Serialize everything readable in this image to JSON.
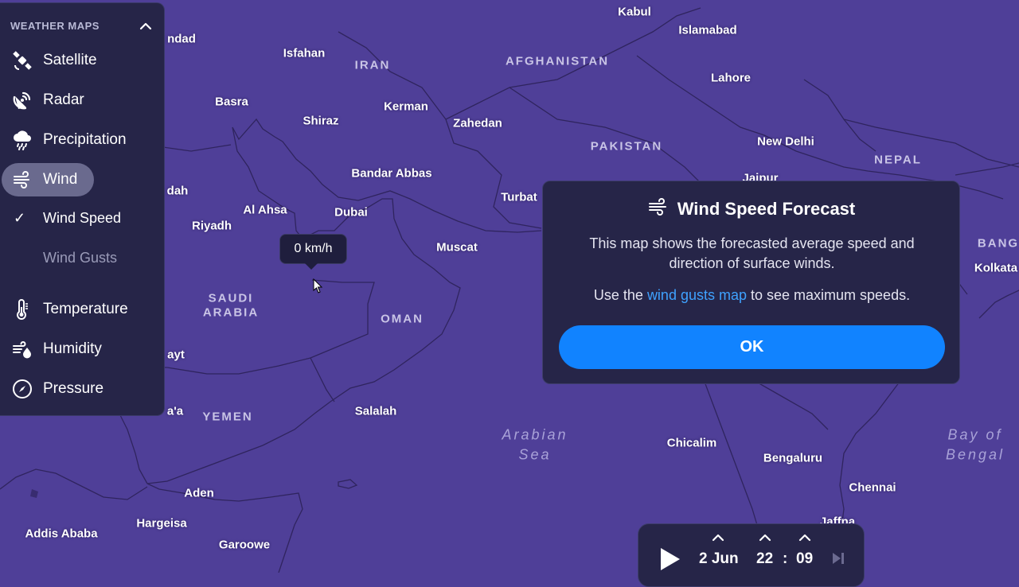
{
  "sidebar": {
    "heading": "WEATHER MAPS",
    "items": [
      {
        "label": "Satellite",
        "icon": "satellite-icon"
      },
      {
        "label": "Radar",
        "icon": "radar-icon"
      },
      {
        "label": "Precipitation",
        "icon": "precipitation-icon"
      },
      {
        "label": "Wind",
        "icon": "wind-icon",
        "active": true
      },
      {
        "label": "Temperature",
        "icon": "thermometer-icon"
      },
      {
        "label": "Humidity",
        "icon": "humidity-icon"
      },
      {
        "label": "Pressure",
        "icon": "compass-icon"
      }
    ],
    "subitems": [
      {
        "label": "Wind Speed",
        "checked": true
      },
      {
        "label": "Wind Gusts",
        "checked": false
      }
    ],
    "check_mark": "✓"
  },
  "map": {
    "cities": [
      "ndad",
      "Isfahan",
      "Basra",
      "Shiraz",
      "Kerman",
      "Zahedan",
      "Bandar Abbas",
      "Kabul",
      "Islamabad",
      "Lahore",
      "New Delhi",
      "Jaipur",
      "Turbat",
      "Muscat",
      "dah",
      "Riyadh",
      "Al Ahsa",
      "Dubai",
      "ayt",
      "Salalah",
      "a'a",
      "Aden",
      "Hargeisa",
      "Garoowe",
      "Addis Ababa",
      "Chicalim",
      "Bengaluru",
      "Chennai",
      "Jaffna",
      "Kolkata"
    ],
    "countries": [
      "IRAN",
      "AFGHANISTAN",
      "PAKISTAN",
      "NEPAL",
      "SAUDI",
      "ARABIA",
      "OMAN",
      "YEMEN",
      "BANG"
    ],
    "seas": [
      "Arabian",
      "Sea",
      "Bay of",
      "Bengal"
    ]
  },
  "tooltip": {
    "value": "0 km/h"
  },
  "dialog": {
    "title": "Wind Speed Forecast",
    "body": "This map shows the forecasted average speed and direction of surface winds.",
    "body2_prefix": "Use the ",
    "body2_link": "wind gusts map",
    "body2_suffix": " to see maximum speeds.",
    "ok_label": "OK"
  },
  "timeline": {
    "date": "2 Jun",
    "hour": "22",
    "separator": ":",
    "minute": "09"
  },
  "colors": {
    "map_bg": "#4f3f98",
    "panel": "#262548",
    "accent": "#1183ff",
    "link": "#3fa2ff"
  }
}
